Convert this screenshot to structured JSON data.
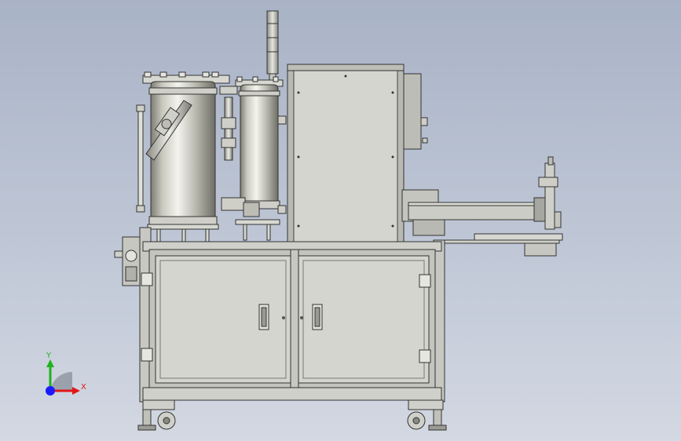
{
  "triad": {
    "y_label": "Y",
    "x_label": "X",
    "y_color": "#1fb21f",
    "x_color": "#e01818",
    "z_color": "#1a1aff"
  },
  "colors": {
    "frame": "#c7c8c2",
    "panel": "#d4d5cf",
    "steel_dark": "#8a8a82",
    "steel_light": "#f0f0ea",
    "line": "#2a2a2a"
  }
}
